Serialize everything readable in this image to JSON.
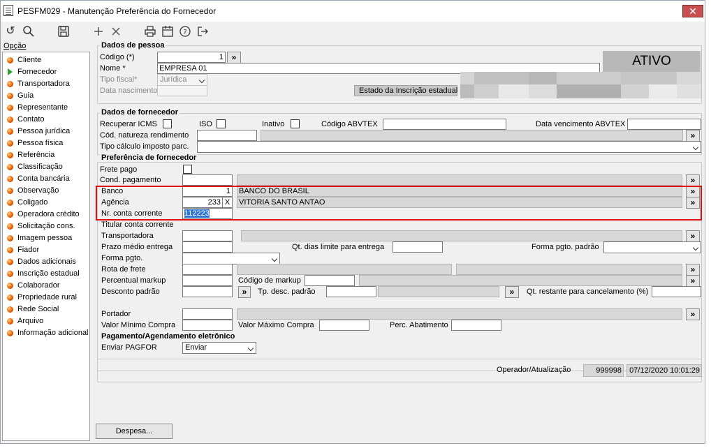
{
  "window": {
    "title": "PESFM029 - Manutenção Preferência do Fornecedor"
  },
  "toolbar": {
    "icons": [
      "undo-icon",
      "search-icon",
      "save-icon",
      "add-icon",
      "delete-icon",
      "print-icon",
      "calendar-icon",
      "help-icon",
      "exit-icon"
    ]
  },
  "sidebar": {
    "header": "Opção",
    "items": [
      "Cliente",
      "Fornecedor",
      "Transportadora",
      "Guia",
      "Representante",
      "Contato",
      "Pessoa jurídica",
      "Pessoa física",
      "Referência",
      "Classificação",
      "Conta bancária",
      "Observação",
      "Coligado",
      "Operadora crédito",
      "Solicitação cons.",
      "Imagem pessoa",
      "Fiador",
      "Dados adicionais",
      "Inscrição estadual",
      "Colaborador",
      "Propriedade rural",
      "Rede Social",
      "Arquivo",
      "Informação adicional"
    ],
    "selected": "Fornecedor"
  },
  "pessoa": {
    "title": "Dados de pessoa",
    "codigo_label": "Código (*)",
    "codigo_value": "1",
    "nome_label": "Nome *",
    "nome_value": "EMPRESA 01",
    "tipo_fiscal_label": "Tipo fiscal*",
    "tipo_fiscal_value": "Jurídica",
    "data_nasc_label": "Data nascimento",
    "estado_ie_label": "Estado da Inscrição estadual",
    "status": "ATIVO"
  },
  "fornecedor": {
    "title": "Dados de fornecedor",
    "recuperar_icms": "Recuperar ICMS",
    "iso": "ISO",
    "inativo": "Inativo",
    "codigo_abvtex": "Código ABVTEX",
    "data_venc_abvtex": "Data vencimento ABVTEX",
    "cod_natureza": "Cód. natureza rendimento",
    "tipo_calculo": "Tipo cálculo imposto parc."
  },
  "preferencia": {
    "title": "Preferência de fornecedor",
    "frete_pago": "Frete pago",
    "cond_pagamento": "Cond. pagamento",
    "banco_label": "Banco",
    "banco_code": "1",
    "banco_name": "BANCO DO BRASIL",
    "agencia_label": "Agência",
    "agencia_code": "233",
    "agencia_digit": "X",
    "agencia_name": "VITORIA SANTO ANTAO",
    "conta_label": "Nr. conta corrente",
    "conta_value": "112223",
    "titular_label": "Titular conta corrente",
    "transportadora_label": "Transportadora",
    "prazo_label": "Prazo médio entrega",
    "qt_dias_label": "Qt. dias limite para entrega",
    "forma_pgto_padrao_label": "Forma pgto. padrão",
    "forma_pgto_label": "Forma pgto.",
    "rota_label": "Rota de frete",
    "percentual_markup_label": "Percentual markup",
    "codigo_markup_label": "Código de markup",
    "desconto_label": "Desconto padrão",
    "tp_desc_label": "Tp. desc. padrão",
    "qt_restante_label": "Qt. restante para cancelamento (%)",
    "portador_label": "Portador",
    "valor_min_label": "Valor Mínimo Compra",
    "valor_max_label": "Valor Máximo Compra",
    "perc_abat_label": "Perc. Abatimento"
  },
  "pagamento": {
    "title": "Pagamento/Agendamento eletrônico",
    "enviar_label": "Enviar PAGFOR",
    "enviar_value": "Enviar"
  },
  "footer": {
    "operador_label": "Operador/Atualização",
    "operador_value": "999998",
    "atualizacao_value": "07/12/2020 10:01:29",
    "despesa_button": "Despesa..."
  },
  "glyphs": {
    "lookup": "»",
    "close": "✕"
  },
  "colors": {
    "highlight": "#e01010",
    "selection": "#3075d0",
    "status_bg": "#b8b8b8"
  }
}
